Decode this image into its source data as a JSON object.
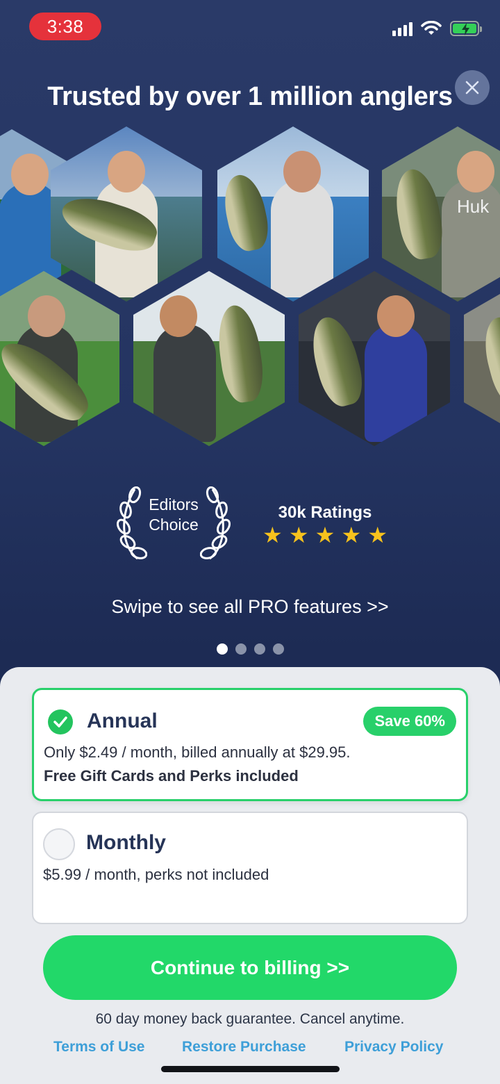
{
  "status_bar": {
    "time": "3:38",
    "colors": {
      "time_pill": "#e5323b",
      "battery": "#34d058"
    }
  },
  "header": {
    "title": "Trusted by over 1 million anglers",
    "close_icon": "close-icon"
  },
  "photos": [
    {
      "icon": "angler-photo",
      "watermark": ""
    },
    {
      "icon": "angler-photo",
      "watermark": ""
    },
    {
      "icon": "angler-photo",
      "watermark": ""
    },
    {
      "icon": "angler-photo",
      "watermark": "Huk"
    },
    {
      "icon": "angler-photo",
      "watermark": ""
    },
    {
      "icon": "angler-photo",
      "watermark": ""
    },
    {
      "icon": "angler-photo",
      "watermark": ""
    },
    {
      "icon": "angler-photo",
      "watermark": ""
    }
  ],
  "badges": {
    "editors_line1": "Editors",
    "editors_line2": "Choice",
    "ratings_label": "30k Ratings",
    "stars": [
      "★",
      "★",
      "★",
      "★",
      "★"
    ],
    "star_color": "#f7c21d"
  },
  "carousel": {
    "swipe_text": "Swipe to see all PRO features >>",
    "pages": 4,
    "active_page": 1
  },
  "plans": {
    "annual": {
      "title": "Annual",
      "badge": "Save 60%",
      "description": "Only $2.49 / month, billed annually at $29.95.",
      "perks": "Free Gift Cards and Perks included",
      "selected": true
    },
    "monthly": {
      "title": "Monthly",
      "description": "$5.99 / month, perks not included",
      "selected": false
    }
  },
  "cta": {
    "label": "Continue to billing >>",
    "color": "#22d869"
  },
  "footer": {
    "guarantee": "60 day money back guarantee. Cancel anytime.",
    "terms": "Terms of Use",
    "restore": "Restore Purchase",
    "privacy": "Privacy Policy",
    "link_color": "#3e9fd8"
  }
}
